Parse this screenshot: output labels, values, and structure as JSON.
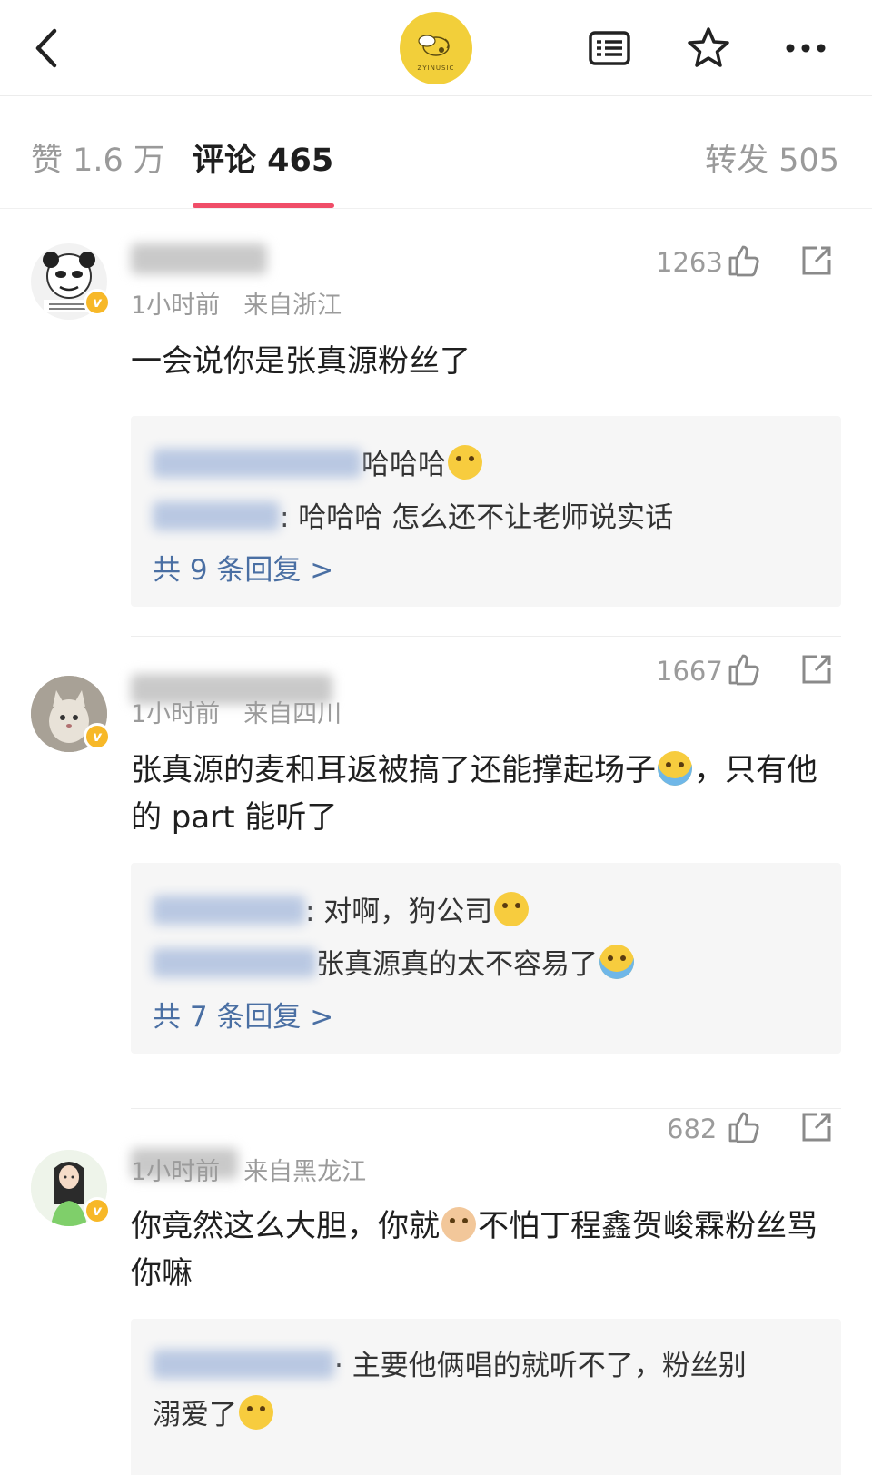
{
  "header": {
    "back_icon": "chevron-left-icon",
    "logo_text": "ZYINUSIC",
    "icons": [
      "list-icon",
      "star-icon",
      "more-icon"
    ]
  },
  "tabs": {
    "like": "赞 1.6 万",
    "comment": "评论 465",
    "repost": "转发 505"
  },
  "comments": [
    {
      "likes": "1263",
      "time": "1小时前",
      "location": "来自浙江",
      "text": "一会说你是张真源粉丝了",
      "replies": [
        {
          "text": "哈哈哈"
        },
        {
          "text": ": 哈哈哈 怎么还不让老师说实话"
        }
      ],
      "more": "共 9 条回复 >"
    },
    {
      "likes": "1667",
      "time": "1小时前",
      "location": "来自四川",
      "text_a": "张真源的麦和耳返被搞了还能撑起场子",
      "text_b": "，只有他的 part 能听了",
      "replies": [
        {
          "text": ": 对啊，狗公司"
        },
        {
          "text": "张真源真的太不容易了"
        }
      ],
      "more": "共 7 条回复 >"
    },
    {
      "likes": "682",
      "time": "1小时前",
      "location": "来自黑龙江",
      "text_a": "你竟然这么大胆，你就",
      "text_b": "不怕丁程鑫贺峻霖粉丝骂你嘛",
      "replies": [
        {
          "text_a": "· 主要他俩唱的就听不了，粉丝别",
          "text_b": "溺爱了"
        }
      ]
    }
  ],
  "colors": {
    "accent": "#f04d68",
    "link": "#4a6fa3",
    "badge": "#f7b828",
    "logo": "#f2cf3a"
  }
}
